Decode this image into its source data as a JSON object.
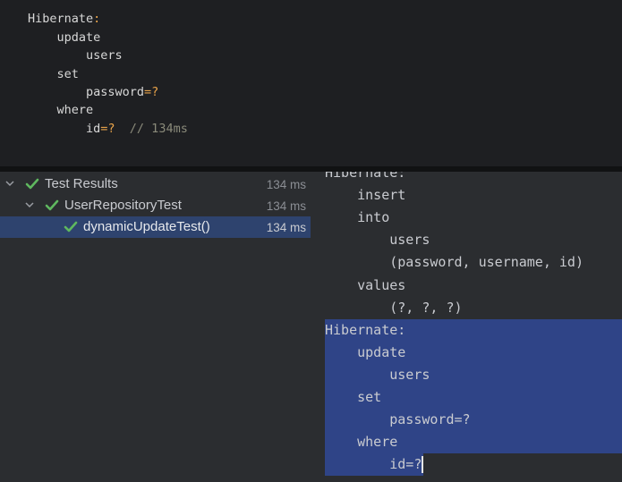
{
  "snippet": {
    "line1_label": "Hibernate",
    "line1_colon": ":",
    "line2": "    update",
    "line3": "        users",
    "line4": "    set",
    "line5_a": "        password",
    "line5_b": "=?",
    "line6": "    where",
    "line7_a": "        id",
    "line7_b": "=?",
    "line7_comment": "  // 134ms"
  },
  "tree": {
    "rows": [
      {
        "label": "Test Results",
        "time": "134 ms"
      },
      {
        "label": "UserRepositoryTest",
        "time": "134 ms"
      },
      {
        "label": "dynamicUpdateTest()",
        "time": "134 ms"
      }
    ]
  },
  "console": {
    "lines": [
      "Hibernate:",
      "    insert",
      "    into",
      "        users",
      "        (password, username, id)",
      "    values",
      "        (?, ?, ?)",
      "Hibernate:",
      "    update",
      "        users",
      "    set",
      "        password=?",
      "    where",
      "        id=?"
    ]
  },
  "colors": {
    "editor_bg": "#1e1f22",
    "panel_bg": "#2b2d30",
    "selection": "#2f4487",
    "tree_selection": "#2e436e",
    "success_green": "#5fb85f",
    "operator_orange": "#e8a34a"
  }
}
